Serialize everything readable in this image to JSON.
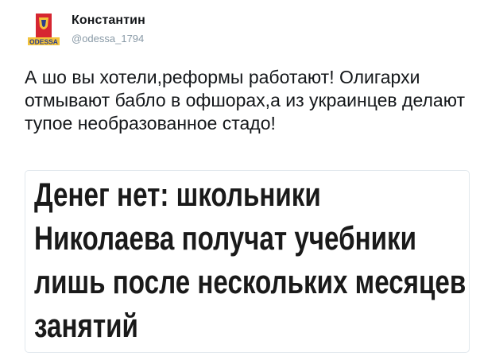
{
  "author": {
    "display_name": "Константин",
    "handle": "@odessa_1794",
    "avatar_text": "ODESSA"
  },
  "tweet": {
    "text": "А шо вы хотели,реформы работают! Олигархи отмывают бабло в офшорах,а из украинцев делают тупое необразованное стадо!"
  },
  "card": {
    "headline": "Денег нет: школьники Николаева получат учебники лишь после нескольких месяцев занятий"
  },
  "colors": {
    "avatar_red": "#d62631",
    "avatar_blue": "#2b3e8c",
    "avatar_yellow": "#f3c33c"
  }
}
